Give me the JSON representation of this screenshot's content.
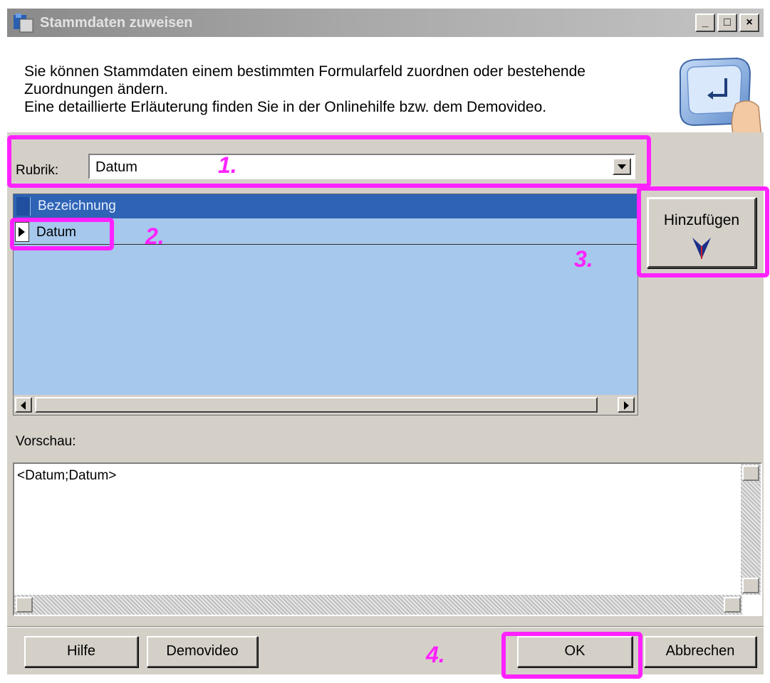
{
  "window": {
    "title": "Stammdaten zuweisen",
    "minimize_glyph": "_",
    "maximize_glyph": "□",
    "close_glyph": "×"
  },
  "header": {
    "line1": "Sie können Stammdaten einem bestimmten Formularfeld zuordnen oder bestehende",
    "line2": "Zuordnungen ändern.",
    "line3": "Eine detaillierte Erläuterung finden Sie in der Onlinehilfe bzw. dem Demovideo."
  },
  "rubrik": {
    "label": "Rubrik:",
    "value": "Datum"
  },
  "grid": {
    "column_header": "Bezeichnung",
    "rows": [
      "Datum"
    ]
  },
  "add_button": {
    "label": "Hinzufügen",
    "icon": "arrow-down-icon"
  },
  "preview": {
    "label": "Vorschau:",
    "text": "<Datum;Datum>"
  },
  "buttons": {
    "help": "Hilfe",
    "demo": "Demovideo",
    "ok": "OK",
    "cancel": "Abbrechen"
  },
  "annotations": {
    "step1": "1.",
    "step2": "2.",
    "step3": "3.",
    "step4": "4."
  },
  "colors": {
    "highlight": "#ff22ff",
    "grid_background": "#a6c8ec",
    "grid_header": "#2e63b5",
    "dialog_gray": "#d4d0c8"
  }
}
